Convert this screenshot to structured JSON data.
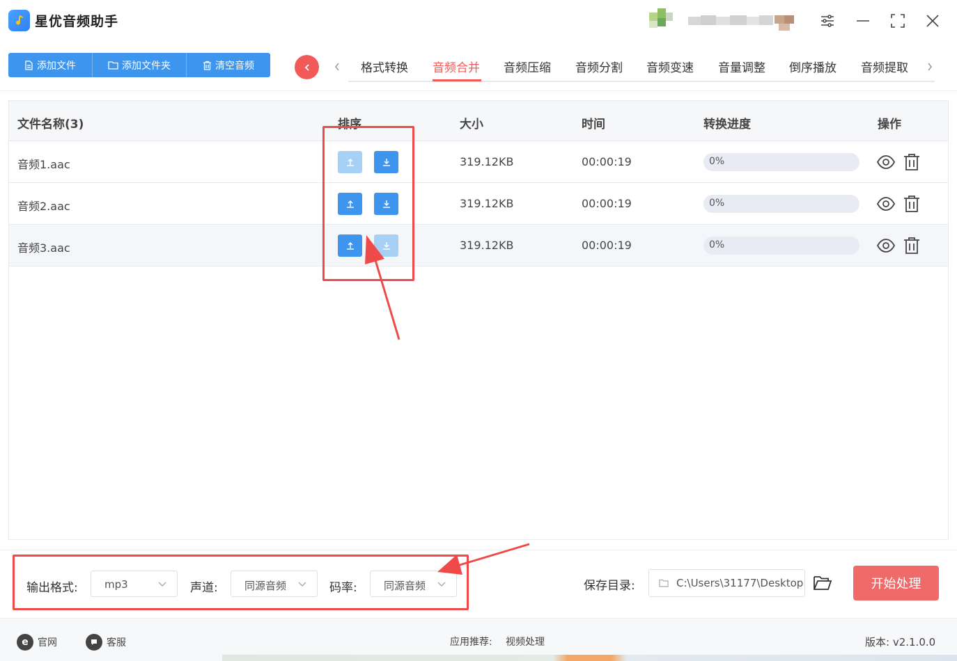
{
  "app": {
    "title": "星优音频助手"
  },
  "toolbar": {
    "add_file": "添加文件",
    "add_folder": "添加文件夹",
    "clear_audio": "清空音频"
  },
  "tabs": [
    "格式转换",
    "音频合并",
    "音频压缩",
    "音频分割",
    "音频变速",
    "音量调整",
    "倒序播放",
    "音频提取"
  ],
  "active_tab": "音频合并",
  "table": {
    "headers": {
      "name": "文件名称(3)",
      "order": "排序",
      "size": "大小",
      "time": "时间",
      "progress": "转换进度",
      "ops": "操作"
    },
    "rows": [
      {
        "name": "音频1.aac",
        "size": "319.12KB",
        "time": "00:00:19",
        "progress": "0%",
        "progress_value": 0,
        "up_enabled": false,
        "down_enabled": true
      },
      {
        "name": "音频2.aac",
        "size": "319.12KB",
        "time": "00:00:19",
        "progress": "0%",
        "progress_value": 0,
        "up_enabled": true,
        "down_enabled": true
      },
      {
        "name": "音频3.aac",
        "size": "319.12KB",
        "time": "00:00:19",
        "progress": "0%",
        "progress_value": 0,
        "up_enabled": true,
        "down_enabled": false
      }
    ]
  },
  "settings": {
    "format_label": "输出格式:",
    "format_value": "mp3",
    "channel_label": "声道:",
    "channel_value": "同源音频",
    "bitrate_label": "码率:",
    "bitrate_value": "同源音频",
    "save_label": "保存目录:",
    "save_path": "C:\\Users\\31177\\Desktop",
    "start_button": "开始处理"
  },
  "footer": {
    "website": "官网",
    "support": "客服",
    "recommend_label": "应用推荐:",
    "recommend_item": "视频处理",
    "version": "版本:  v2.1.0.0"
  },
  "colors": {
    "primary": "#3e95ed",
    "accent": "#f05a5a",
    "annotation": "#ef4a4a"
  }
}
